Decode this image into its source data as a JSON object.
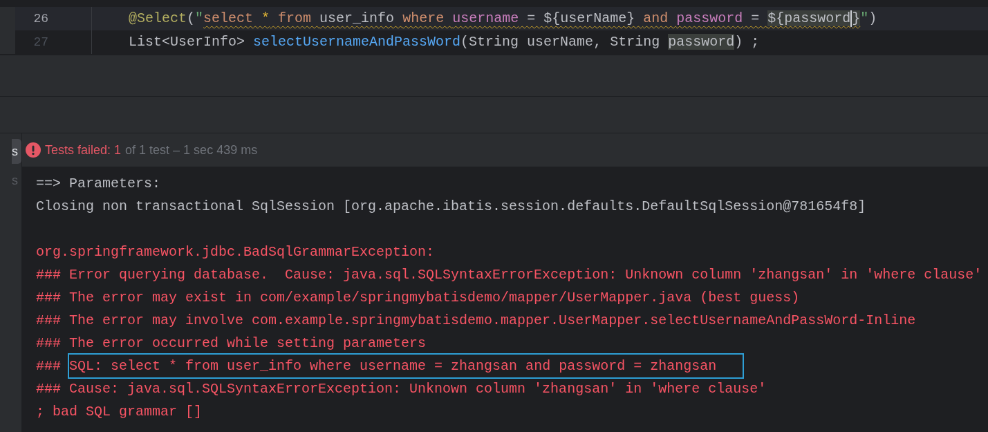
{
  "editor": {
    "lines": [
      {
        "number": "26",
        "current": true,
        "tokens": [
          {
            "kind": "annotation",
            "text": "@Select",
            "squiggle": false
          },
          {
            "kind": "plain",
            "text": "(",
            "squiggle": false
          },
          {
            "kind": "string",
            "text": "\"",
            "squiggle": false
          },
          {
            "kind": "sql_keyword",
            "text": "select ",
            "squiggle": true
          },
          {
            "kind": "star",
            "text": "*",
            "squiggle": true
          },
          {
            "kind": "sql_keyword",
            "text": " from ",
            "squiggle": true
          },
          {
            "kind": "plain",
            "text": "user_info ",
            "squiggle": true
          },
          {
            "kind": "sql_keyword",
            "text": "where ",
            "squiggle": true
          },
          {
            "kind": "column",
            "text": "username",
            "squiggle": true
          },
          {
            "kind": "plain",
            "text": " = ${userName} ",
            "squiggle": true
          },
          {
            "kind": "sql_keyword",
            "text": "and ",
            "squiggle": true
          },
          {
            "kind": "column",
            "text": "password",
            "squiggle": true
          },
          {
            "kind": "plain",
            "text": " = ",
            "squiggle": true
          },
          {
            "kind": "highlight",
            "text": "${password",
            "squiggle": true
          },
          {
            "kind": "caret"
          },
          {
            "kind": "highlight",
            "text": "}",
            "squiggle": true
          },
          {
            "kind": "string",
            "text": "\"",
            "squiggle": false
          },
          {
            "kind": "plain",
            "text": ")",
            "squiggle": false
          }
        ]
      },
      {
        "number": "27",
        "current": false,
        "tokens": [
          {
            "kind": "plain",
            "text": "List<UserInfo> ",
            "squiggle": false
          },
          {
            "kind": "method",
            "text": "selectUsernameAndPassWord",
            "squiggle": false
          },
          {
            "kind": "plain",
            "text": "(String userName, String ",
            "squiggle": false
          },
          {
            "kind": "highlight",
            "text": "password",
            "squiggle": false
          },
          {
            "kind": "plain",
            "text": ") ;",
            "squiggle": false
          }
        ]
      }
    ]
  },
  "side_tabs": [
    {
      "label": "s",
      "selected": true
    },
    {
      "label": "s",
      "selected": false
    }
  ],
  "test_status": {
    "failed_label": "Tests failed: 1",
    "detail": "of 1 test – 1 sec 439 ms"
  },
  "console": [
    {
      "kind": "normal",
      "text": "==> Parameters:"
    },
    {
      "kind": "normal",
      "text": "Closing non transactional SqlSession [org.apache.ibatis.session.defaults.DefaultSqlSession@781654f8]"
    },
    {
      "kind": "blank"
    },
    {
      "kind": "error",
      "text": "org.springframework.jdbc.BadSqlGrammarException: "
    },
    {
      "kind": "error",
      "text": "### Error querying database.  Cause: java.sql.SQLSyntaxErrorException: Unknown column 'zhangsan' in 'where clause'"
    },
    {
      "kind": "error",
      "text": "### The error may exist in com/example/springmybatisdemo/mapper/UserMapper.java (best guess)"
    },
    {
      "kind": "error",
      "text": "### The error may involve com.example.springmybatisdemo.mapper.UserMapper.selectUsernameAndPassWord-Inline"
    },
    {
      "kind": "error",
      "text": "### The error occurred while setting parameters"
    },
    {
      "kind": "error",
      "text": "### ",
      "boxed": "SQL: select * from user_info where username = zhangsan and password = zhangsan"
    },
    {
      "kind": "error",
      "text": "### Cause: java.sql.SQLSyntaxErrorException: Unknown column 'zhangsan' in 'where clause'"
    },
    {
      "kind": "error",
      "text": "; bad SQL grammar []"
    }
  ]
}
